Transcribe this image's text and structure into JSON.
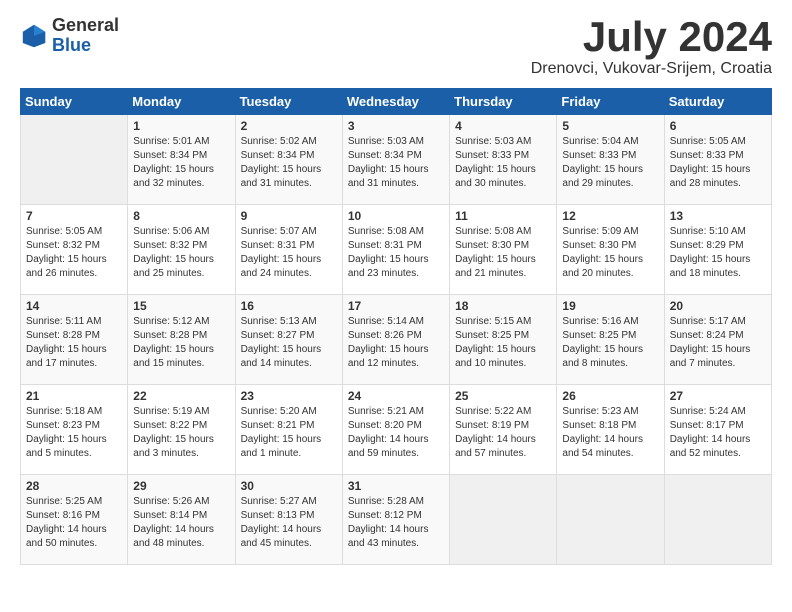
{
  "header": {
    "logo_general": "General",
    "logo_blue": "Blue",
    "month": "July 2024",
    "location": "Drenovci, Vukovar-Srijem, Croatia"
  },
  "days_of_week": [
    "Sunday",
    "Monday",
    "Tuesday",
    "Wednesday",
    "Thursday",
    "Friday",
    "Saturday"
  ],
  "weeks": [
    [
      {
        "num": "",
        "info": ""
      },
      {
        "num": "1",
        "info": "Sunrise: 5:01 AM\nSunset: 8:34 PM\nDaylight: 15 hours\nand 32 minutes."
      },
      {
        "num": "2",
        "info": "Sunrise: 5:02 AM\nSunset: 8:34 PM\nDaylight: 15 hours\nand 31 minutes."
      },
      {
        "num": "3",
        "info": "Sunrise: 5:03 AM\nSunset: 8:34 PM\nDaylight: 15 hours\nand 31 minutes."
      },
      {
        "num": "4",
        "info": "Sunrise: 5:03 AM\nSunset: 8:33 PM\nDaylight: 15 hours\nand 30 minutes."
      },
      {
        "num": "5",
        "info": "Sunrise: 5:04 AM\nSunset: 8:33 PM\nDaylight: 15 hours\nand 29 minutes."
      },
      {
        "num": "6",
        "info": "Sunrise: 5:05 AM\nSunset: 8:33 PM\nDaylight: 15 hours\nand 28 minutes."
      }
    ],
    [
      {
        "num": "7",
        "info": "Sunrise: 5:05 AM\nSunset: 8:32 PM\nDaylight: 15 hours\nand 26 minutes."
      },
      {
        "num": "8",
        "info": "Sunrise: 5:06 AM\nSunset: 8:32 PM\nDaylight: 15 hours\nand 25 minutes."
      },
      {
        "num": "9",
        "info": "Sunrise: 5:07 AM\nSunset: 8:31 PM\nDaylight: 15 hours\nand 24 minutes."
      },
      {
        "num": "10",
        "info": "Sunrise: 5:08 AM\nSunset: 8:31 PM\nDaylight: 15 hours\nand 23 minutes."
      },
      {
        "num": "11",
        "info": "Sunrise: 5:08 AM\nSunset: 8:30 PM\nDaylight: 15 hours\nand 21 minutes."
      },
      {
        "num": "12",
        "info": "Sunrise: 5:09 AM\nSunset: 8:30 PM\nDaylight: 15 hours\nand 20 minutes."
      },
      {
        "num": "13",
        "info": "Sunrise: 5:10 AM\nSunset: 8:29 PM\nDaylight: 15 hours\nand 18 minutes."
      }
    ],
    [
      {
        "num": "14",
        "info": "Sunrise: 5:11 AM\nSunset: 8:28 PM\nDaylight: 15 hours\nand 17 minutes."
      },
      {
        "num": "15",
        "info": "Sunrise: 5:12 AM\nSunset: 8:28 PM\nDaylight: 15 hours\nand 15 minutes."
      },
      {
        "num": "16",
        "info": "Sunrise: 5:13 AM\nSunset: 8:27 PM\nDaylight: 15 hours\nand 14 minutes."
      },
      {
        "num": "17",
        "info": "Sunrise: 5:14 AM\nSunset: 8:26 PM\nDaylight: 15 hours\nand 12 minutes."
      },
      {
        "num": "18",
        "info": "Sunrise: 5:15 AM\nSunset: 8:25 PM\nDaylight: 15 hours\nand 10 minutes."
      },
      {
        "num": "19",
        "info": "Sunrise: 5:16 AM\nSunset: 8:25 PM\nDaylight: 15 hours\nand 8 minutes."
      },
      {
        "num": "20",
        "info": "Sunrise: 5:17 AM\nSunset: 8:24 PM\nDaylight: 15 hours\nand 7 minutes."
      }
    ],
    [
      {
        "num": "21",
        "info": "Sunrise: 5:18 AM\nSunset: 8:23 PM\nDaylight: 15 hours\nand 5 minutes."
      },
      {
        "num": "22",
        "info": "Sunrise: 5:19 AM\nSunset: 8:22 PM\nDaylight: 15 hours\nand 3 minutes."
      },
      {
        "num": "23",
        "info": "Sunrise: 5:20 AM\nSunset: 8:21 PM\nDaylight: 15 hours\nand 1 minute."
      },
      {
        "num": "24",
        "info": "Sunrise: 5:21 AM\nSunset: 8:20 PM\nDaylight: 14 hours\nand 59 minutes."
      },
      {
        "num": "25",
        "info": "Sunrise: 5:22 AM\nSunset: 8:19 PM\nDaylight: 14 hours\nand 57 minutes."
      },
      {
        "num": "26",
        "info": "Sunrise: 5:23 AM\nSunset: 8:18 PM\nDaylight: 14 hours\nand 54 minutes."
      },
      {
        "num": "27",
        "info": "Sunrise: 5:24 AM\nSunset: 8:17 PM\nDaylight: 14 hours\nand 52 minutes."
      }
    ],
    [
      {
        "num": "28",
        "info": "Sunrise: 5:25 AM\nSunset: 8:16 PM\nDaylight: 14 hours\nand 50 minutes."
      },
      {
        "num": "29",
        "info": "Sunrise: 5:26 AM\nSunset: 8:14 PM\nDaylight: 14 hours\nand 48 minutes."
      },
      {
        "num": "30",
        "info": "Sunrise: 5:27 AM\nSunset: 8:13 PM\nDaylight: 14 hours\nand 45 minutes."
      },
      {
        "num": "31",
        "info": "Sunrise: 5:28 AM\nSunset: 8:12 PM\nDaylight: 14 hours\nand 43 minutes."
      },
      {
        "num": "",
        "info": ""
      },
      {
        "num": "",
        "info": ""
      },
      {
        "num": "",
        "info": ""
      }
    ]
  ]
}
